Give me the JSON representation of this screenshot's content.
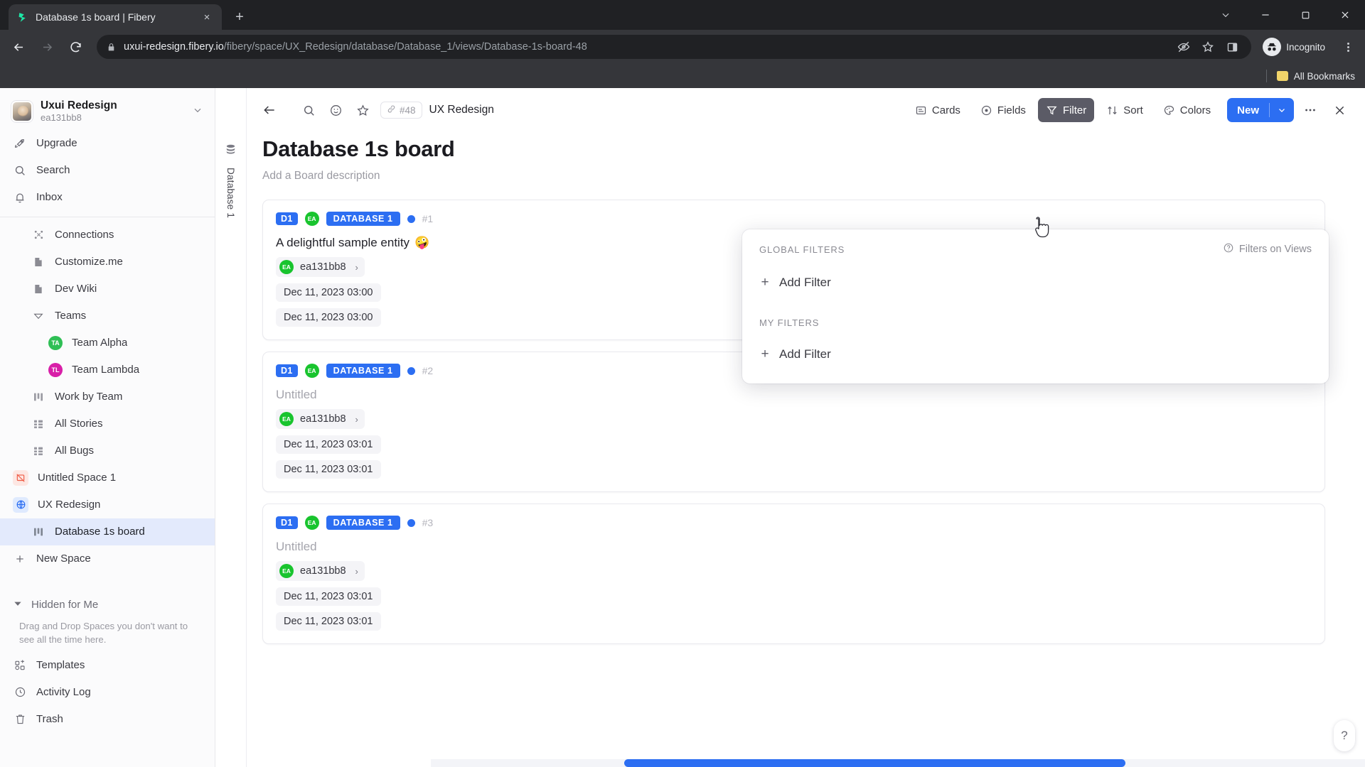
{
  "browser": {
    "tab": {
      "title": "Database 1s board | Fibery",
      "favicon": "fibery-logo-icon",
      "close": "×",
      "newtab": "+"
    },
    "window_controls": [
      "chevron-down-icon",
      "minimize-icon",
      "maximize-icon",
      "close-icon"
    ],
    "nav": {
      "back": "←",
      "forward": "→",
      "reload": "⟳"
    },
    "omnibox": {
      "lock_icon": "lock-icon",
      "url_domain": "uxui-redesign.fibery.io",
      "url_path": "/fibery/space/UX_Redesign/database/Database_1/views/Database-1s-board-48",
      "actions": [
        "eye-slash-icon",
        "star-icon",
        "side-panel-icon"
      ]
    },
    "profile": {
      "label": "Incognito",
      "icon": "incognito-icon"
    },
    "bookmarks": {
      "label": "All Bookmarks",
      "icon": "folder-icon"
    }
  },
  "sidebar": {
    "workspace": {
      "name": "Uxui Redesign",
      "sub": "ea131bb8",
      "chevron": "chevron-down-icon"
    },
    "quick": [
      {
        "label": "Upgrade",
        "icon": "rocket-icon"
      },
      {
        "label": "Search",
        "icon": "search-icon"
      },
      {
        "label": "Inbox",
        "icon": "bell-icon"
      }
    ],
    "items": [
      {
        "label": "Connections",
        "icon": "connections-icon",
        "indent": 1
      },
      {
        "label": "Customize.me",
        "icon": "document-icon",
        "indent": 1
      },
      {
        "label": "Dev Wiki",
        "icon": "document-icon",
        "indent": 1
      },
      {
        "label": "Teams",
        "icon": "chevron-collapse-icon",
        "indent": 1
      },
      {
        "label": "Team Alpha",
        "icon": "avatar-ta",
        "initials": "TA",
        "color": "#2fbf55",
        "indent": 2
      },
      {
        "label": "Team Lambda",
        "icon": "avatar-tl",
        "initials": "TL",
        "color": "#d81fa8",
        "indent": 2
      },
      {
        "label": "Work by Team",
        "icon": "board-icon",
        "indent": 1
      },
      {
        "label": "All Stories",
        "icon": "grid-icon",
        "indent": 1
      },
      {
        "label": "All Bugs",
        "icon": "grid-icon",
        "indent": 1
      },
      {
        "label": "Untitled Space 1",
        "icon": "space-crossed-icon",
        "color": "#ef5b45",
        "bg": "#fde7e3",
        "indent": 0
      },
      {
        "label": "UX Redesign",
        "icon": "globe-icon",
        "color": "#2c6ef2",
        "bg": "#dfeafe",
        "indent": 0
      },
      {
        "label": "Database 1s board",
        "icon": "board-icon",
        "indent": 1,
        "active": true
      },
      {
        "label": "New Space",
        "icon": "plus-icon",
        "indent": 0
      }
    ],
    "hidden": {
      "label": "Hidden for Me",
      "icon": "triangle-down-icon",
      "description": "Drag and Drop Spaces you don't want to see all the time here."
    },
    "bottom": [
      {
        "label": "Templates",
        "icon": "templates-icon"
      },
      {
        "label": "Activity Log",
        "icon": "clock-icon"
      },
      {
        "label": "Trash",
        "icon": "trash-icon"
      }
    ]
  },
  "rail": {
    "icon": "database-icon",
    "label": "Database 1"
  },
  "topbar": {
    "back": "back-arrow-icon",
    "icons": [
      "search-icon",
      "emoji-icon",
      "star-icon"
    ],
    "id_pill": {
      "icon": "link-icon",
      "text": "#48"
    },
    "breadcrumb": "UX Redesign",
    "buttons": [
      {
        "label": "Cards",
        "icon": "cards-icon",
        "pressed": false
      },
      {
        "label": "Fields",
        "icon": "fields-icon",
        "pressed": false
      },
      {
        "label": "Filter",
        "icon": "filter-icon",
        "pressed": true
      },
      {
        "label": "Sort",
        "icon": "sort-icon",
        "pressed": false
      },
      {
        "label": "Colors",
        "icon": "colors-icon",
        "pressed": false
      }
    ],
    "new_button": {
      "label": "New",
      "caret": "chevron-down-icon"
    },
    "more": "more-dots-icon",
    "close": "close-icon"
  },
  "board": {
    "title": "Database 1s board",
    "description_placeholder": "Add a Board description",
    "cards": [
      {
        "tag": "D1",
        "avatar_initials": "EA",
        "database": "DATABASE 1",
        "number": "#1",
        "title": "A delightful sample entity",
        "emoji": "🤪",
        "untitled": false,
        "owner": "ea131bb8",
        "owner_initials": "EA",
        "chevron": "›",
        "dates": [
          "Dec 11, 2023 03:00",
          "Dec 11, 2023 03:00"
        ]
      },
      {
        "tag": "D1",
        "avatar_initials": "EA",
        "database": "DATABASE 1",
        "number": "#2",
        "title": "Untitled",
        "emoji": "",
        "untitled": true,
        "owner": "ea131bb8",
        "owner_initials": "EA",
        "chevron": "›",
        "dates": [
          "Dec 11, 2023 03:01",
          "Dec 11, 2023 03:01"
        ]
      },
      {
        "tag": "D1",
        "avatar_initials": "EA",
        "database": "DATABASE 1",
        "number": "#3",
        "title": "Untitled",
        "emoji": "",
        "untitled": true,
        "owner": "ea131bb8",
        "owner_initials": "EA",
        "chevron": "›",
        "dates": [
          "Dec 11, 2023 03:01",
          "Dec 11, 2023 03:01"
        ]
      }
    ]
  },
  "filter_popover": {
    "global_label": "GLOBAL FILTERS",
    "global_add": "Add Filter",
    "my_label": "MY FILTERS",
    "my_add": "Add Filter",
    "help_link": "Filters on Views",
    "help_icon": "question-circle-icon",
    "plus": "+"
  },
  "help_fab": {
    "label": "?",
    "icon": "question-icon"
  },
  "colors": {
    "accent": "#2c6ef2",
    "green": "#19c42e",
    "pressed_bg": "#5b5b66",
    "sidebar_active": "#e3eafc"
  }
}
